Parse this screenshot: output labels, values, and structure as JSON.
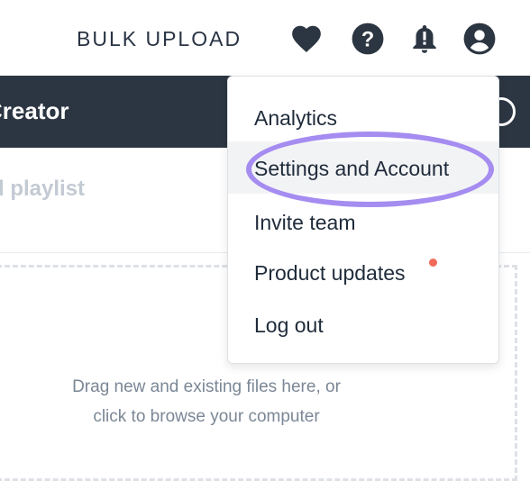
{
  "header": {
    "bulk_upload_label": "BULK UPLOAD",
    "icons": [
      "heart-icon",
      "help-icon",
      "bell-icon",
      "user-icon"
    ]
  },
  "titlebar": {
    "title": "Creator"
  },
  "subheader": {
    "label": "d playlist"
  },
  "dropzone": {
    "line1": "Drag new and existing files here, or",
    "line2": "click to browse your computer"
  },
  "menu": {
    "items": [
      {
        "label": "Analytics"
      },
      {
        "label": "Settings and Account"
      },
      {
        "label": "Invite team"
      },
      {
        "label": "Product updates"
      },
      {
        "label": "Log out"
      }
    ],
    "highlighted_item": "Settings and Account"
  },
  "colors": {
    "titlebar_bg": "#2c3642",
    "highlight_ring": "#a58cf0",
    "notification_dot": "#f06a5a",
    "icon_color": "#2c3642"
  }
}
